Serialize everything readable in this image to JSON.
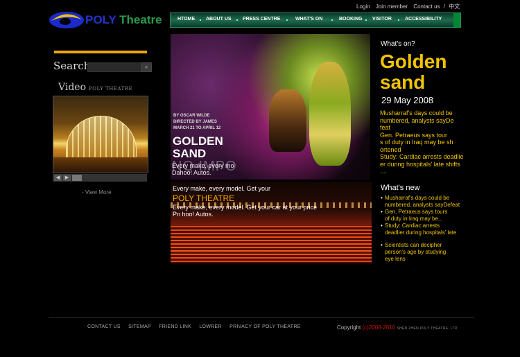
{
  "top_links": {
    "login": "Login",
    "join": "Join member",
    "contact": "Contact us",
    "sep": "/",
    "lang": "中文"
  },
  "logo": {
    "poly": "POLY",
    "theatre": "Theatre"
  },
  "nav": [
    "HTOME",
    "ABOUT US",
    "PRESS CENTRE",
    "WHAT'S ON",
    "BOOKING",
    "VISITOR",
    "ACCESSIBILITY"
  ],
  "search": {
    "label": "Search",
    "button": "»"
  },
  "video": {
    "label": "Video",
    "sub": "POLY THEATRE",
    "view_more": "- View More",
    "prev": "◀",
    "next": "▶"
  },
  "hero": {
    "by": "BY OSCAR WILDE",
    "directed": "DIRECTED BY JAMES",
    "dates": "MARCH 21 TO APRIL 12",
    "title1": "GOLDEN",
    "title2": "SAND",
    "ghost": "NO IMPO",
    "line1": "Every make, every mo",
    "line2": "Dahoo! Autos."
  },
  "hall": {
    "line1": "Every make, every model. Get your",
    "line2": "POLY THEATRE",
    "line3": "Every make, every model. Get your car at your price",
    "line4": "Pn hoo! Autos."
  },
  "whats_on": {
    "heading": "What's on?",
    "title1": "Golden",
    "title2": "sand",
    "date": "29 May 2008",
    "news": [
      "Musharraf's days could be",
      "numbered, analysts sayDe",
      "feat",
      "Gen. Petraeus says tour",
      "s of duty in Iraq may be sh",
      "ortened",
      "Study: Cardiac arrests deadlie",
      "er during hospitals' late shifts",
      "...."
    ]
  },
  "whats_new": {
    "heading": "What's new",
    "items": [
      [
        "Musharraf's days could be",
        "numbered, analysts sayDefeat"
      ],
      [
        "Gen. Petraeus says tours",
        "of duty in Iraq may be..."
      ],
      [
        "Study: Cardiac arrests",
        "deadlier during hospitals' late"
      ],
      [
        "Scientists can decipher",
        "person's age by studying",
        "eye lens"
      ]
    ],
    "bullet": "•"
  },
  "footer": {
    "links": [
      "CONTACT US",
      "SITEMAP",
      "FRIEND LINK",
      "LOWRER",
      "PRIVACY OF POLY THEATRE"
    ],
    "copyright": "Copyright",
    "years": "(c)2008-2010",
    "company": "SHEN ZHEN POLY THEATRE, LTD"
  },
  "colors": {
    "accent": "#f0c400",
    "bar": "#f0a800",
    "nav": "#1f6b4e",
    "red": "#d01010"
  }
}
